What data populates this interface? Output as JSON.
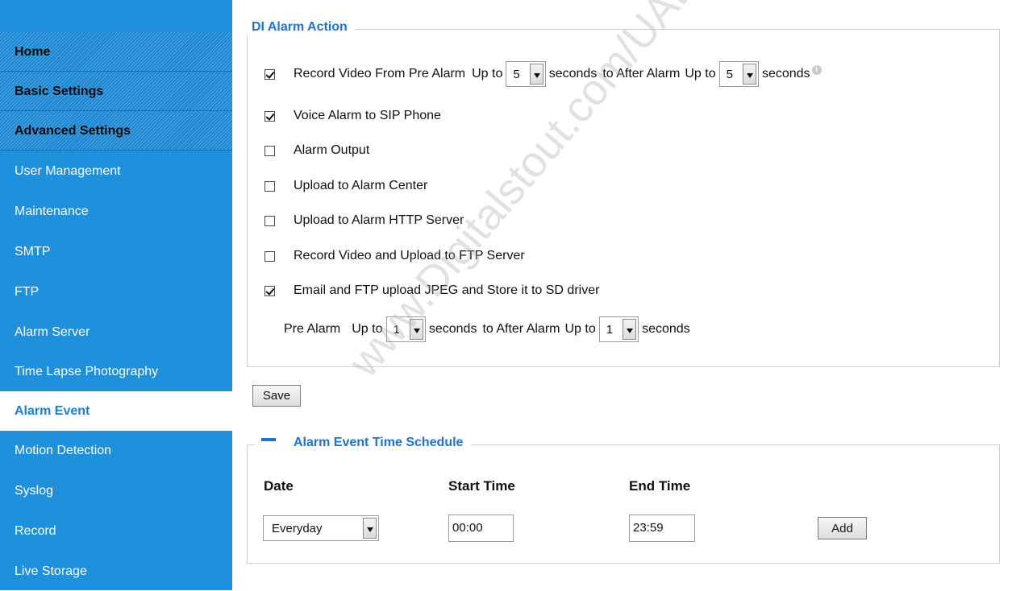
{
  "sidebar": {
    "items": [
      {
        "label": "Home",
        "type": "section"
      },
      {
        "label": "Basic Settings",
        "type": "section"
      },
      {
        "label": "Advanced Settings",
        "type": "section"
      },
      {
        "label": "User Management",
        "type": "link"
      },
      {
        "label": "Maintenance",
        "type": "link"
      },
      {
        "label": "SMTP",
        "type": "link"
      },
      {
        "label": "FTP",
        "type": "link"
      },
      {
        "label": "Alarm Server",
        "type": "link"
      },
      {
        "label": "Time Lapse Photography",
        "type": "link"
      },
      {
        "label": "Alarm Event",
        "type": "active"
      },
      {
        "label": "Motion Detection",
        "type": "link"
      },
      {
        "label": "Syslog",
        "type": "link"
      },
      {
        "label": "Record",
        "type": "link"
      },
      {
        "label": "Live Storage",
        "type": "link"
      }
    ]
  },
  "di_alarm": {
    "title": "DI Alarm Action",
    "record_pre": {
      "checked": true,
      "label": "Record Video From Pre Alarm",
      "up_to": "Up to",
      "pre_value": "5",
      "seconds_to": "seconds",
      "after_label": "to After Alarm",
      "up_to2": "Up to",
      "after_value": "5",
      "seconds": "seconds"
    },
    "voice_sip": {
      "checked": true,
      "label": "Voice Alarm to SIP Phone"
    },
    "alarm_output": {
      "checked": false,
      "label": "Alarm Output"
    },
    "upload_center": {
      "checked": false,
      "label": "Upload to Alarm Center"
    },
    "upload_http": {
      "checked": false,
      "label": "Upload to Alarm HTTP Server"
    },
    "record_ftp": {
      "checked": false,
      "label": "Record Video and Upload to FTP Server"
    },
    "email_ftp": {
      "checked": true,
      "label": "Email and FTP upload JPEG and Store it to SD driver"
    },
    "jpeg_pre": {
      "label": "Pre Alarm",
      "up_to": "Up to",
      "pre_value": "1",
      "seconds_to": "seconds",
      "after_label": "to After Alarm",
      "up_to2": "Up to",
      "after_value": "1",
      "seconds": "seconds"
    }
  },
  "save_label": "Save",
  "schedule": {
    "title": "Alarm Event Time Schedule",
    "headers": {
      "date": "Date",
      "start": "Start Time",
      "end": "End Time"
    },
    "date_value": "Everyday",
    "start_value": "00:00",
    "end_value": "23:59",
    "add_label": "Add"
  },
  "watermark": "www.Digitalstout.com/UAE",
  "colors": {
    "sidebar": "#1e90dc",
    "legend": "#1f73c8",
    "active_text": "#1a7fd0"
  }
}
